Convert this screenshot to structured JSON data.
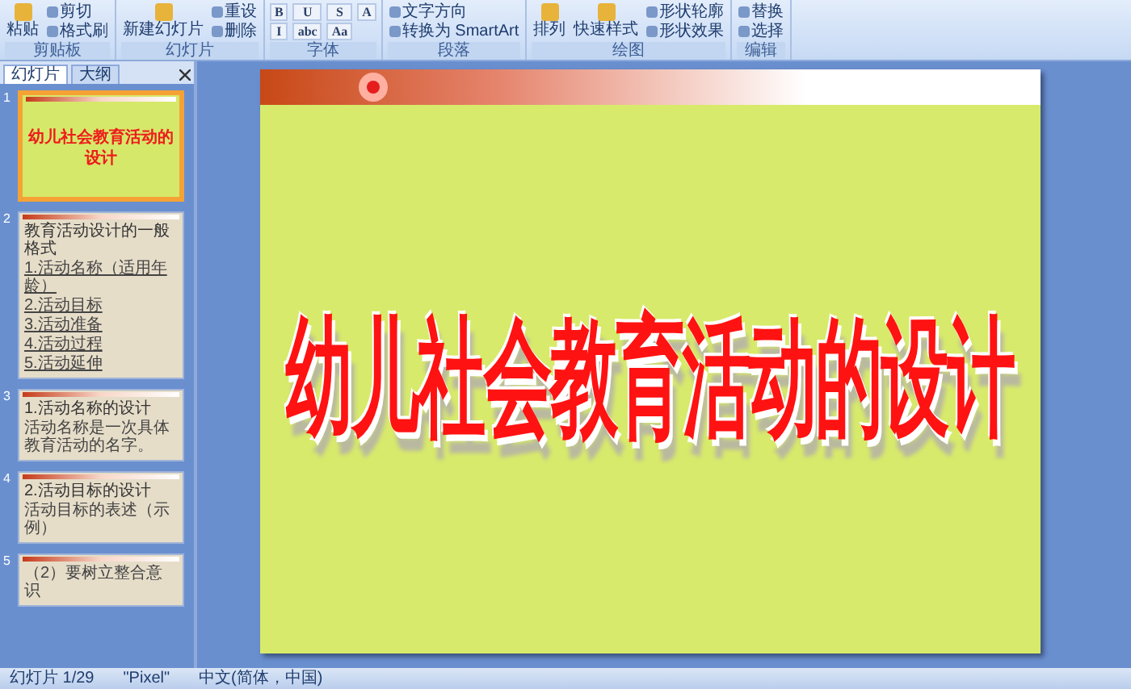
{
  "ribbon": {
    "groups": [
      {
        "label": "剪贴板",
        "items": [
          {
            "kind": "big",
            "label": "粘贴"
          },
          {
            "kind": "small",
            "label": "剪切"
          },
          {
            "kind": "small",
            "label": "格式刷"
          }
        ]
      },
      {
        "label": "幻灯片",
        "items": [
          {
            "kind": "big",
            "label": "新建幻灯片"
          },
          {
            "kind": "small",
            "label": "重设"
          },
          {
            "kind": "small",
            "label": "删除"
          }
        ]
      },
      {
        "label": "字体",
        "items": [
          {
            "kind": "format",
            "label": "B"
          },
          {
            "kind": "format",
            "label": "I"
          },
          {
            "kind": "format",
            "label": "U"
          },
          {
            "kind": "format",
            "label": "abc"
          },
          {
            "kind": "format",
            "label": "S"
          },
          {
            "kind": "format",
            "label": "Aa"
          },
          {
            "kind": "format",
            "label": "A"
          }
        ]
      },
      {
        "label": "段落",
        "items": [
          {
            "kind": "small",
            "label": "文字方向"
          },
          {
            "kind": "small",
            "label": "转换为 SmartArt"
          }
        ]
      },
      {
        "label": "绘图",
        "items": [
          {
            "kind": "big",
            "label": "排列"
          },
          {
            "kind": "big",
            "label": "快速样式"
          },
          {
            "kind": "small",
            "label": "形状轮廓"
          },
          {
            "kind": "small",
            "label": "形状效果"
          }
        ]
      },
      {
        "label": "编辑",
        "items": [
          {
            "kind": "small",
            "label": "替换"
          },
          {
            "kind": "small",
            "label": "选择"
          }
        ]
      }
    ]
  },
  "panel": {
    "tabs": [
      {
        "label": "幻灯片",
        "selected": true
      },
      {
        "label": "大纲",
        "selected": false
      }
    ],
    "thumbnails": [
      {
        "number": "1",
        "selected": true,
        "kind": "cover",
        "title": "幼儿社会教育活动的设计"
      },
      {
        "number": "2",
        "selected": false,
        "kind": "list",
        "title": "教育活动设计的一般格式",
        "lines": [
          "1.活动名称（适用年龄）",
          "2.活动目标",
          "3.活动准备",
          "4.活动过程",
          "5.活动延伸"
        ]
      },
      {
        "number": "3",
        "selected": false,
        "kind": "text",
        "title": "1.活动名称的设计",
        "lines": [
          "活动名称是一次具体教育活动的名字。"
        ]
      },
      {
        "number": "4",
        "selected": false,
        "kind": "text",
        "title": "2.活动目标的设计",
        "lines": [
          "活动目标的表述（示例）"
        ]
      },
      {
        "number": "5",
        "selected": false,
        "kind": "text",
        "lines": [
          "（2）要树立整合意识"
        ]
      }
    ]
  },
  "slide": {
    "title": "幼儿社会教育活动的设计"
  },
  "status_bar": {
    "slide": "幻灯片 1/29",
    "theme": "\"Pixel\"",
    "language": "中文(简体，中国)"
  }
}
